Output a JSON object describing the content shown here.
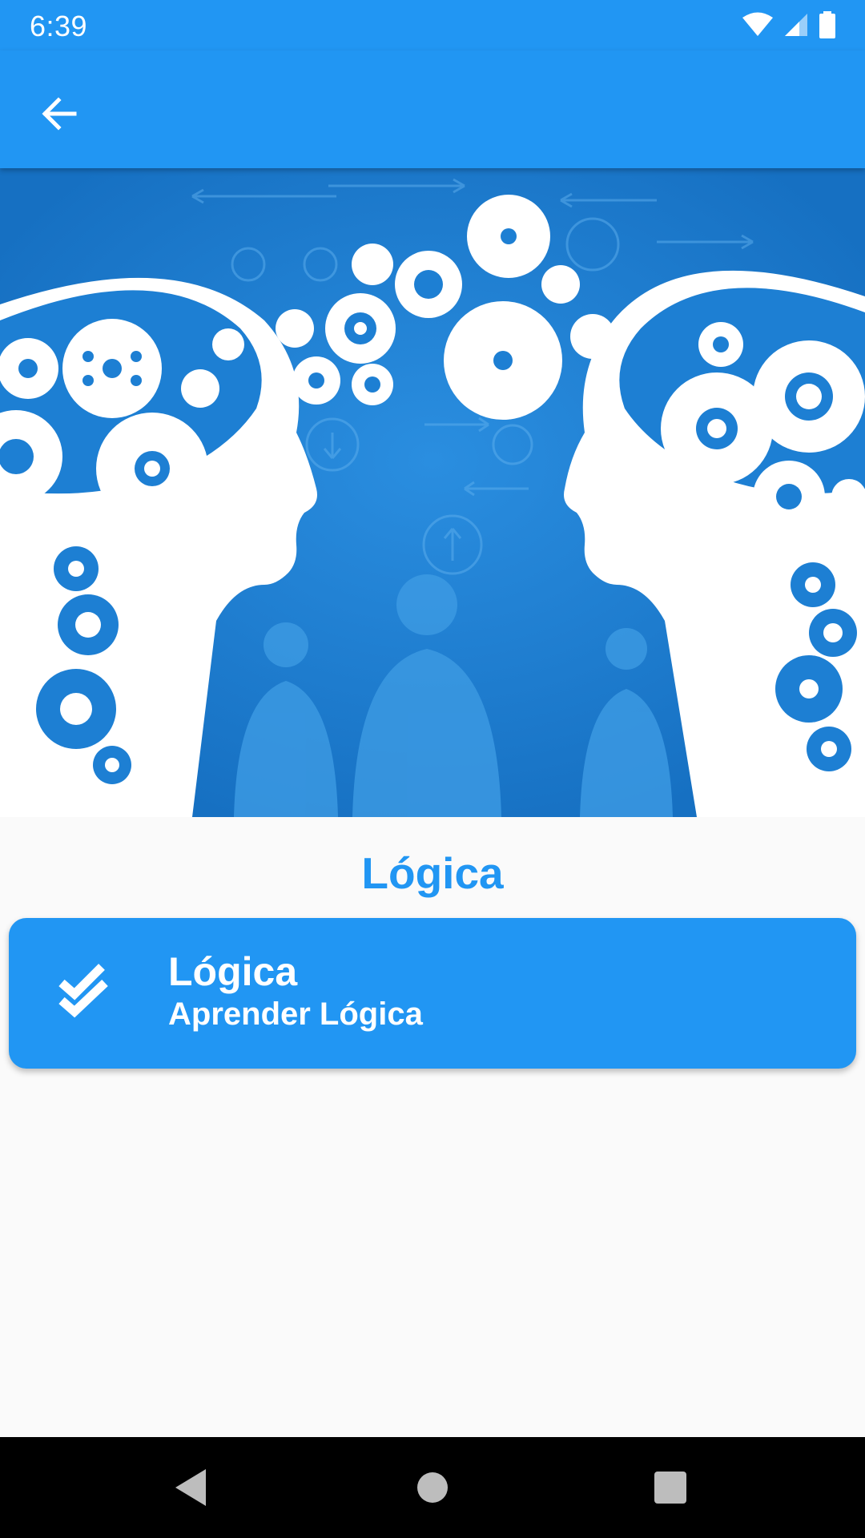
{
  "status_bar": {
    "time": "6:39",
    "icons": [
      "wifi-icon",
      "signal-icon",
      "battery-icon"
    ]
  },
  "app_bar": {
    "back_icon": "arrow-left-icon"
  },
  "hero": {
    "description_icon": "brain-gears-illustration"
  },
  "section": {
    "title": "Lógica"
  },
  "course_card": {
    "icon": "double-check-icon",
    "title": "Lógica",
    "subtitle": "Aprender Lógica"
  },
  "navigation": {
    "buttons": [
      "back-triangle-icon",
      "home-circle-icon",
      "recents-square-icon"
    ]
  },
  "colors": {
    "primary": "#2196f3",
    "hero_background": "#1d7fd3",
    "page_background": "#fafafa",
    "nav_background": "#000000"
  }
}
